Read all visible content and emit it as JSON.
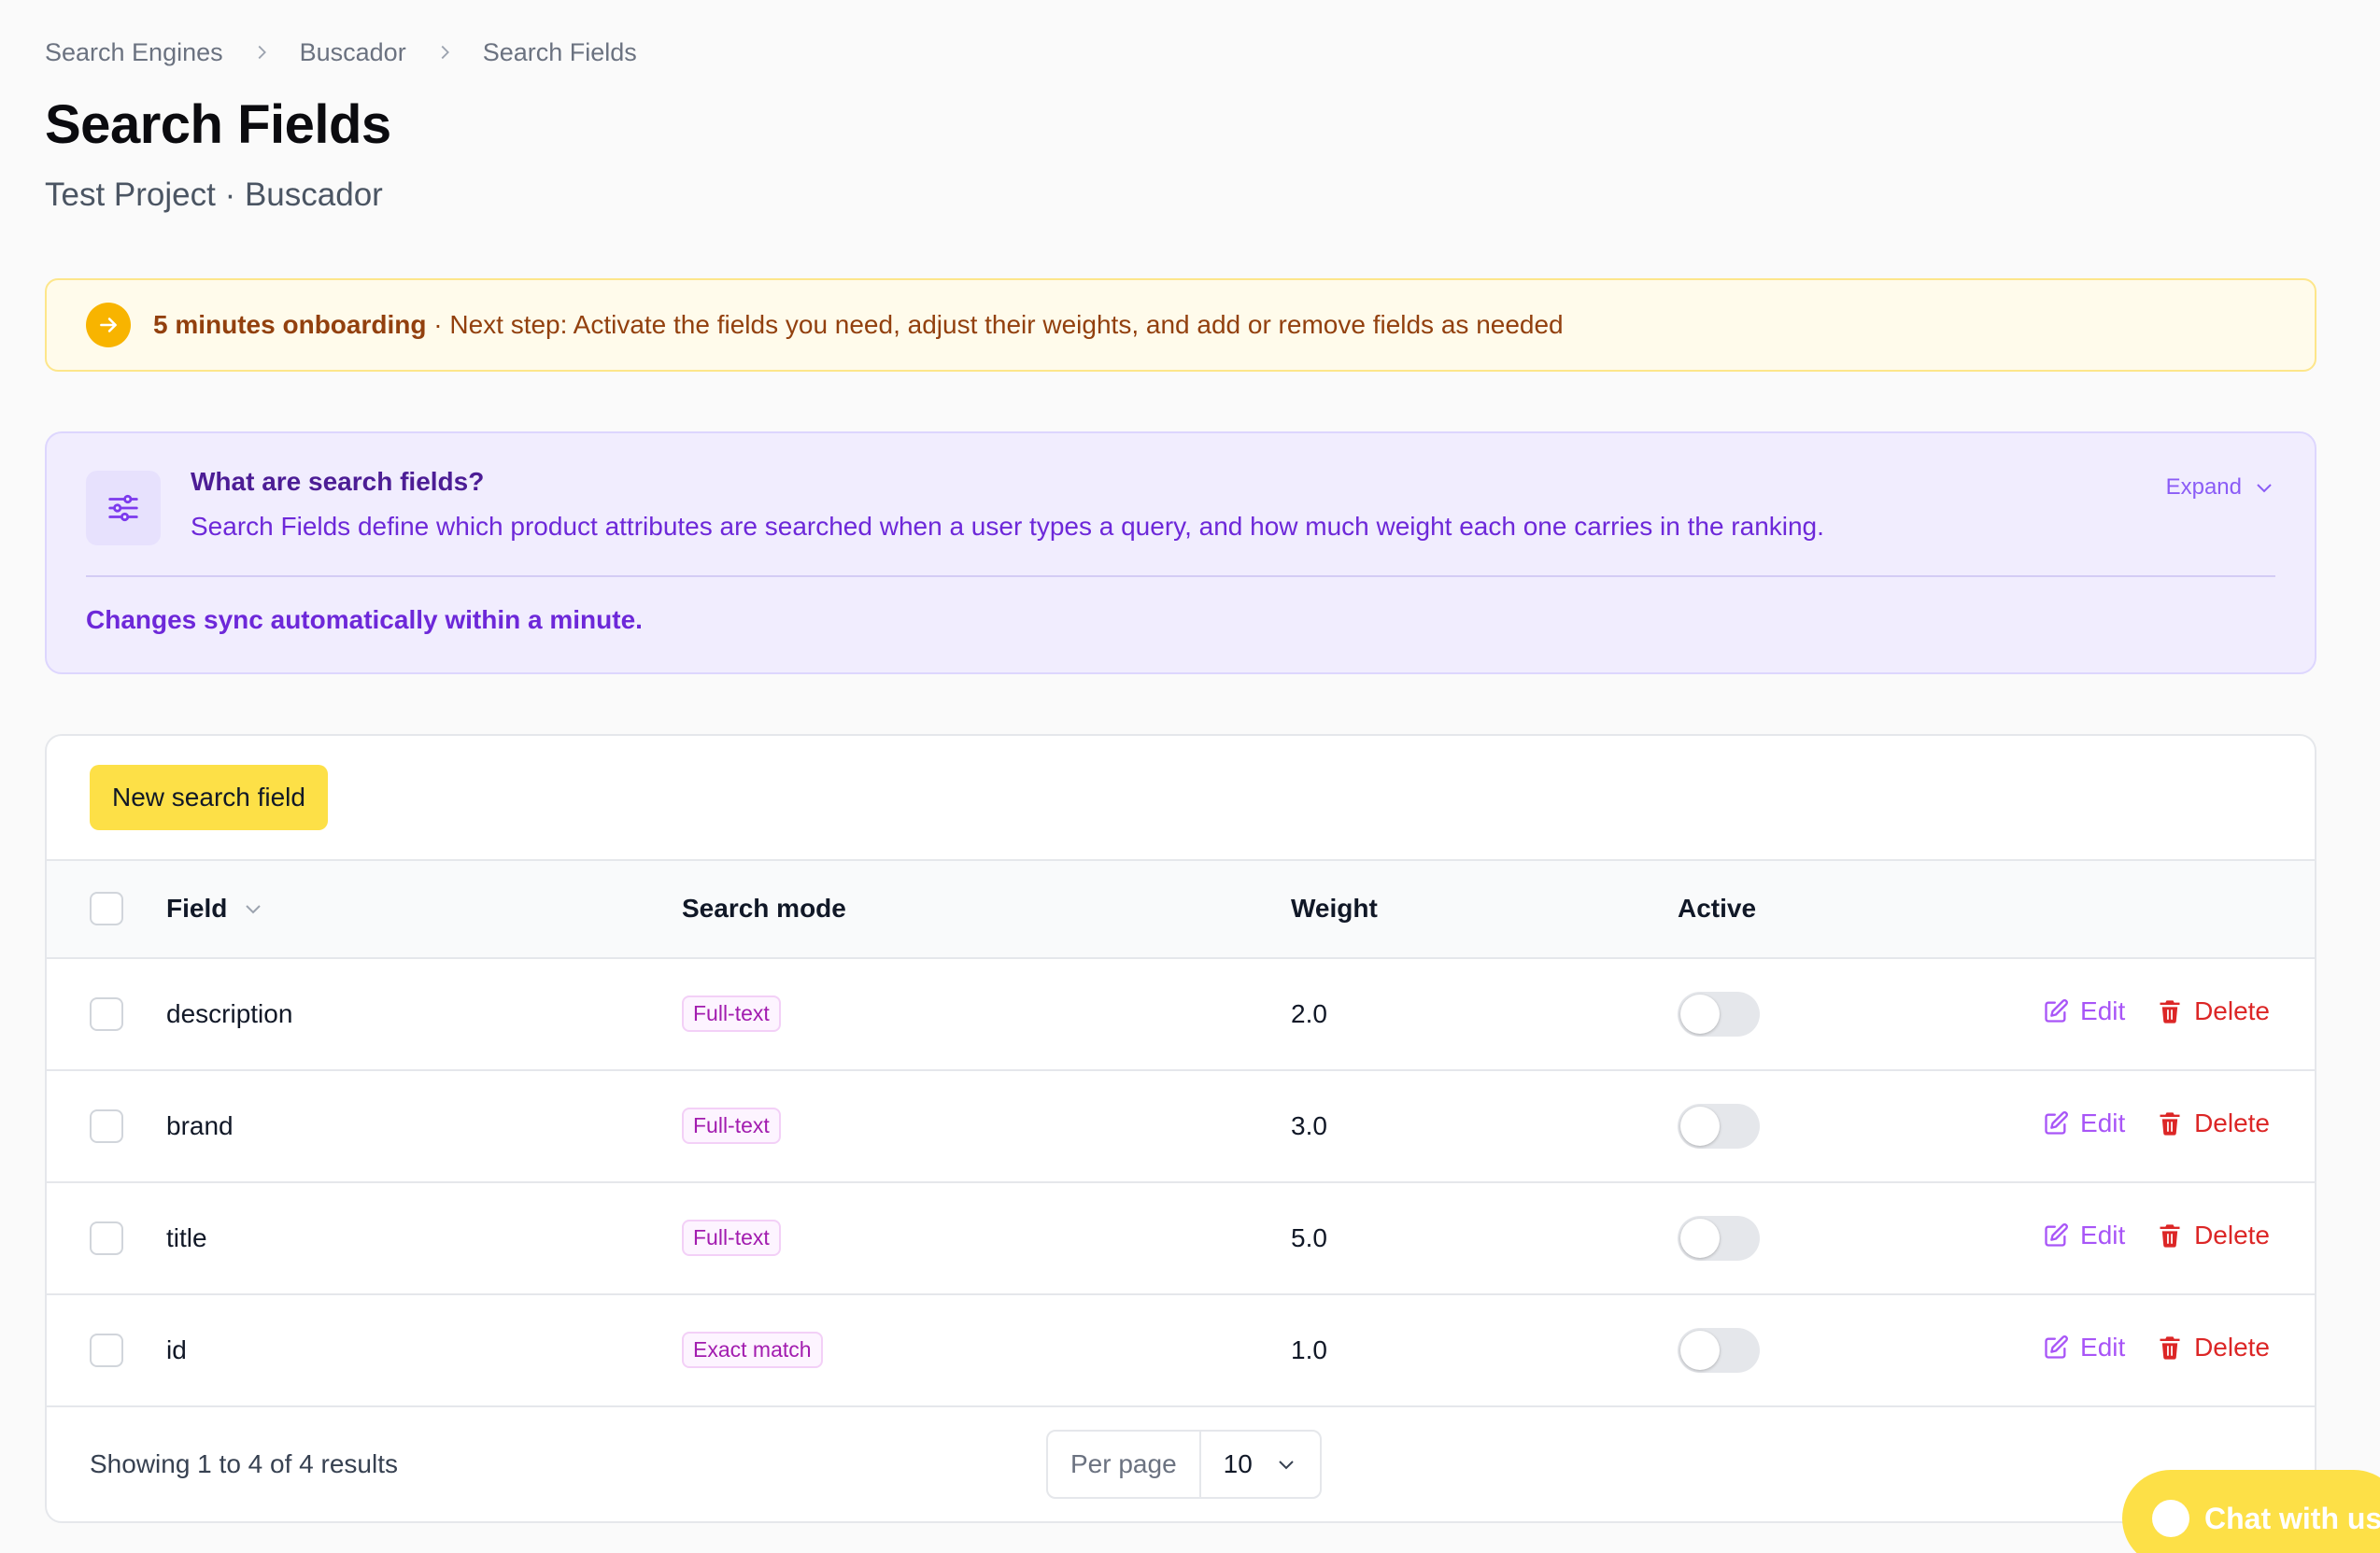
{
  "breadcrumb": [
    "Search Engines",
    "Buscador",
    "Search Fields"
  ],
  "page": {
    "title": "Search Fields",
    "subtitle": "Test Project · Buscador"
  },
  "onboarding": {
    "bold": "5 minutes onboarding",
    "text": " · Next step: Activate the fields you need, adjust their weights, and add or remove fields as needed"
  },
  "info": {
    "title": "What are search fields?",
    "description": "Search Fields define which product attributes are searched when a user types a query, and how much weight each one carries in the ranking.",
    "expand_label": "Expand",
    "note": "Changes sync automatically within a minute."
  },
  "toolbar": {
    "new_label": "New search field"
  },
  "table": {
    "columns": {
      "field": "Field",
      "mode": "Search mode",
      "weight": "Weight",
      "active": "Active"
    },
    "edit_label": "Edit",
    "delete_label": "Delete",
    "rows": [
      {
        "field": "description",
        "mode": "Full-text",
        "weight": "2.0",
        "active": false
      },
      {
        "field": "brand",
        "mode": "Full-text",
        "weight": "3.0",
        "active": false
      },
      {
        "field": "title",
        "mode": "Full-text",
        "weight": "5.0",
        "active": false
      },
      {
        "field": "id",
        "mode": "Exact match",
        "weight": "1.0",
        "active": false
      }
    ]
  },
  "footer": {
    "showing": "Showing 1 to 4 of 4 results",
    "per_page_label": "Per page",
    "per_page_value": "10"
  },
  "chat": {
    "label": "Chat with us"
  },
  "colors": {
    "accent_yellow": "#fde047",
    "purple": "#6d28d9",
    "danger": "#dc2626"
  }
}
